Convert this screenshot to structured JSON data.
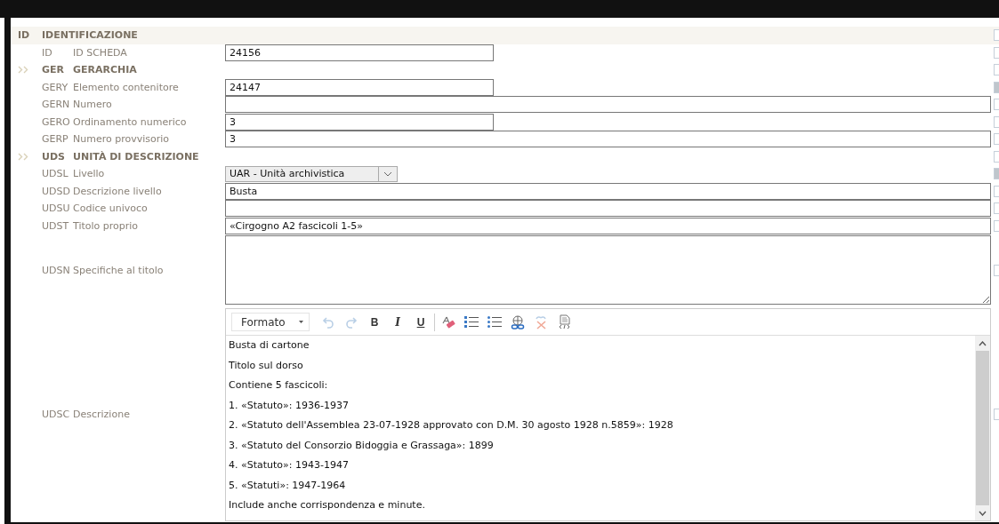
{
  "rows": [
    {
      "kind": "section",
      "code": "ID",
      "label": "IDENTIFICAZIONE",
      "collapsible": false,
      "highlighted": true,
      "side_shaded": false
    },
    {
      "kind": "field",
      "code": "ID",
      "label": "ID SCHEDA",
      "value": "24156",
      "short": true,
      "side_shaded": false
    },
    {
      "kind": "section",
      "code": "GER",
      "label": "GERARCHIA",
      "collapsible": true,
      "highlighted": false,
      "side_shaded": false
    },
    {
      "kind": "field",
      "code": "GERY",
      "label": "Elemento contenitore",
      "value": "24147",
      "short": true,
      "side_shaded": true
    },
    {
      "kind": "field",
      "code": "GERN",
      "label": "Numero",
      "value": "",
      "short": false,
      "side_shaded": false
    },
    {
      "kind": "field",
      "code": "GERO",
      "label": "Ordinamento numerico",
      "value": "3",
      "short": true,
      "side_shaded": false
    },
    {
      "kind": "field",
      "code": "GERP",
      "label": "Numero provvisorio",
      "value": "3",
      "short": false,
      "side_shaded": false
    },
    {
      "kind": "section",
      "code": "UDS",
      "label": "UNITÀ DI DESCRIZIONE",
      "collapsible": true,
      "highlighted": false,
      "side_shaded": false
    },
    {
      "kind": "select",
      "code": "UDSL",
      "label": "Livello",
      "value": "UAR - Unità archivistica",
      "side_shaded": true
    },
    {
      "kind": "field",
      "code": "UDSD",
      "label": "Descrizione livello",
      "value": "Busta",
      "short": false,
      "side_shaded": false
    },
    {
      "kind": "field",
      "code": "UDSU",
      "label": "Codice univoco",
      "value": "",
      "short": false,
      "side_shaded": false
    },
    {
      "kind": "field",
      "code": "UDST",
      "label": "Titolo proprio",
      "value": "«Cirgogno A2 fascicoli 1-5»",
      "short": false,
      "side_shaded": false
    },
    {
      "kind": "textarea",
      "code": "UDSN",
      "label": "Specifiche al titolo",
      "value": "",
      "side_shaded": false
    },
    {
      "kind": "editor",
      "code": "UDSC",
      "label": "Descrizione",
      "side_shaded": false,
      "format": "Formato",
      "tools": [
        {
          "kind": "undo",
          "disabled": true
        },
        {
          "kind": "redo",
          "disabled": true
        },
        {
          "kind": "bold",
          "text": "B",
          "disabled": false
        },
        {
          "kind": "italic",
          "text": "I",
          "disabled": false
        },
        {
          "kind": "underline",
          "text": "U",
          "disabled": false
        },
        {
          "kind": "separator"
        },
        {
          "kind": "eraser",
          "disabled": false
        },
        {
          "kind": "numbered",
          "disabled": false
        },
        {
          "kind": "bulleted",
          "disabled": false
        },
        {
          "kind": "link",
          "disabled": false
        },
        {
          "kind": "unlink",
          "disabled": true
        },
        {
          "kind": "source",
          "disabled": false
        }
      ],
      "lines": [
        "Busta di cartone",
        "Titolo sul dorso",
        "Contiene 5 fascicoli:",
        "1. «Statuto»: 1936-1937",
        "2. «Statuto dell'Assemblea 23-07-1928 approvato con D.M. 30 agosto 1928 n.5859»: 1928",
        "3. «Statuto del Consorzio Bidoggia e Grassaga»: 1899",
        "4. «Statuto»: 1943-1947",
        "5. «Statuti»: 1947-1964",
        "Include anche corrispondenza e minute."
      ]
    }
  ]
}
